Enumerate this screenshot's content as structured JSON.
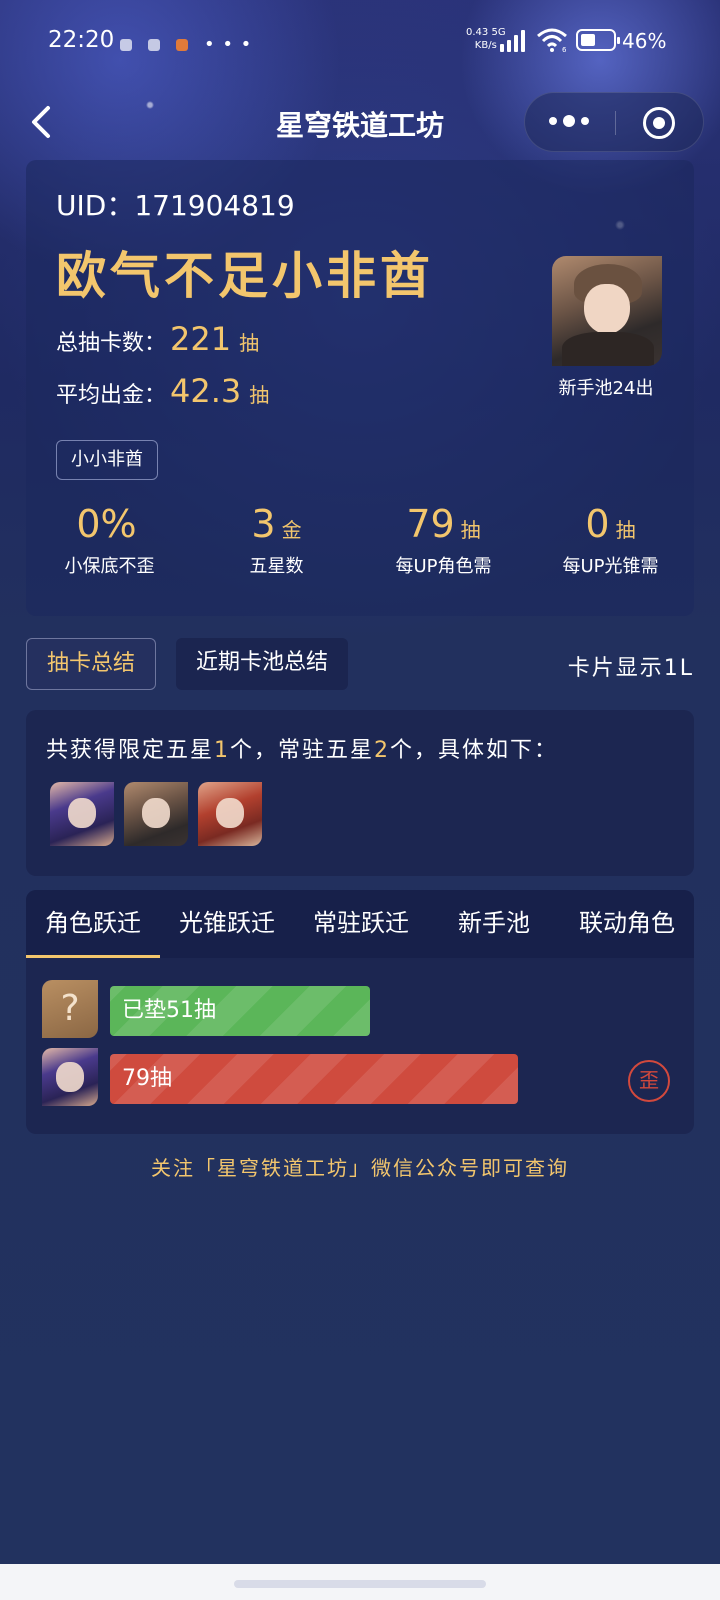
{
  "status_bar": {
    "time": "22:20",
    "more": "• • •",
    "net_speed": "0.43",
    "net_unit": "KB/s",
    "net_type": "5G",
    "wifi_level": "6",
    "battery": "46%"
  },
  "header": {
    "title": "星穹铁道工坊"
  },
  "profile": {
    "uid": "UID：171904819",
    "rank_title": "欧气不足小非酋",
    "total_pulls_label": "总抽卡数：",
    "total_pulls_value": "221",
    "total_pulls_unit": "抽",
    "avg_label": "平均出金：",
    "avg_value": "42.3",
    "avg_unit": "抽",
    "tag": "小小非酋",
    "avatar_caption": "新手池24出"
  },
  "metrics": [
    {
      "value": "0%",
      "unit": "",
      "label": "小保底不歪"
    },
    {
      "value": "3",
      "unit": "金",
      "label": "五星数"
    },
    {
      "value": "79",
      "unit": "抽",
      "label": "每UP角色需"
    },
    {
      "value": "0",
      "unit": "抽",
      "label": "每UP光锥需"
    }
  ],
  "tabs": {
    "summary": "抽卡总结",
    "recent": "近期卡池总结",
    "card_display": "卡片显示1L"
  },
  "summary": {
    "prefix": "共获得限定五星",
    "limited_count": "1",
    "mid": "个，常驻五星",
    "standard_count": "2",
    "suffix": "个，具体如下："
  },
  "characters": [
    "seele",
    "welt",
    "himeko"
  ],
  "pool_tabs": [
    "角色跃迁",
    "光锥跃迁",
    "常驻跃迁",
    "新手池",
    "联动角色"
  ],
  "pity": [
    {
      "thumb": "?",
      "label": "已垫51抽",
      "pulls": 51,
      "color": "#5bb659"
    },
    {
      "label": "79抽",
      "pulls": 79,
      "color": "#cf4b3e",
      "stamp": "歪"
    }
  ],
  "footer": "关注「星穹铁道工坊」微信公众号即可查询",
  "colors": {
    "accent_gold": "#f3c66d",
    "bg": "#22305e",
    "green_bar": "#5bb659",
    "red_bar": "#cf4b3e"
  }
}
